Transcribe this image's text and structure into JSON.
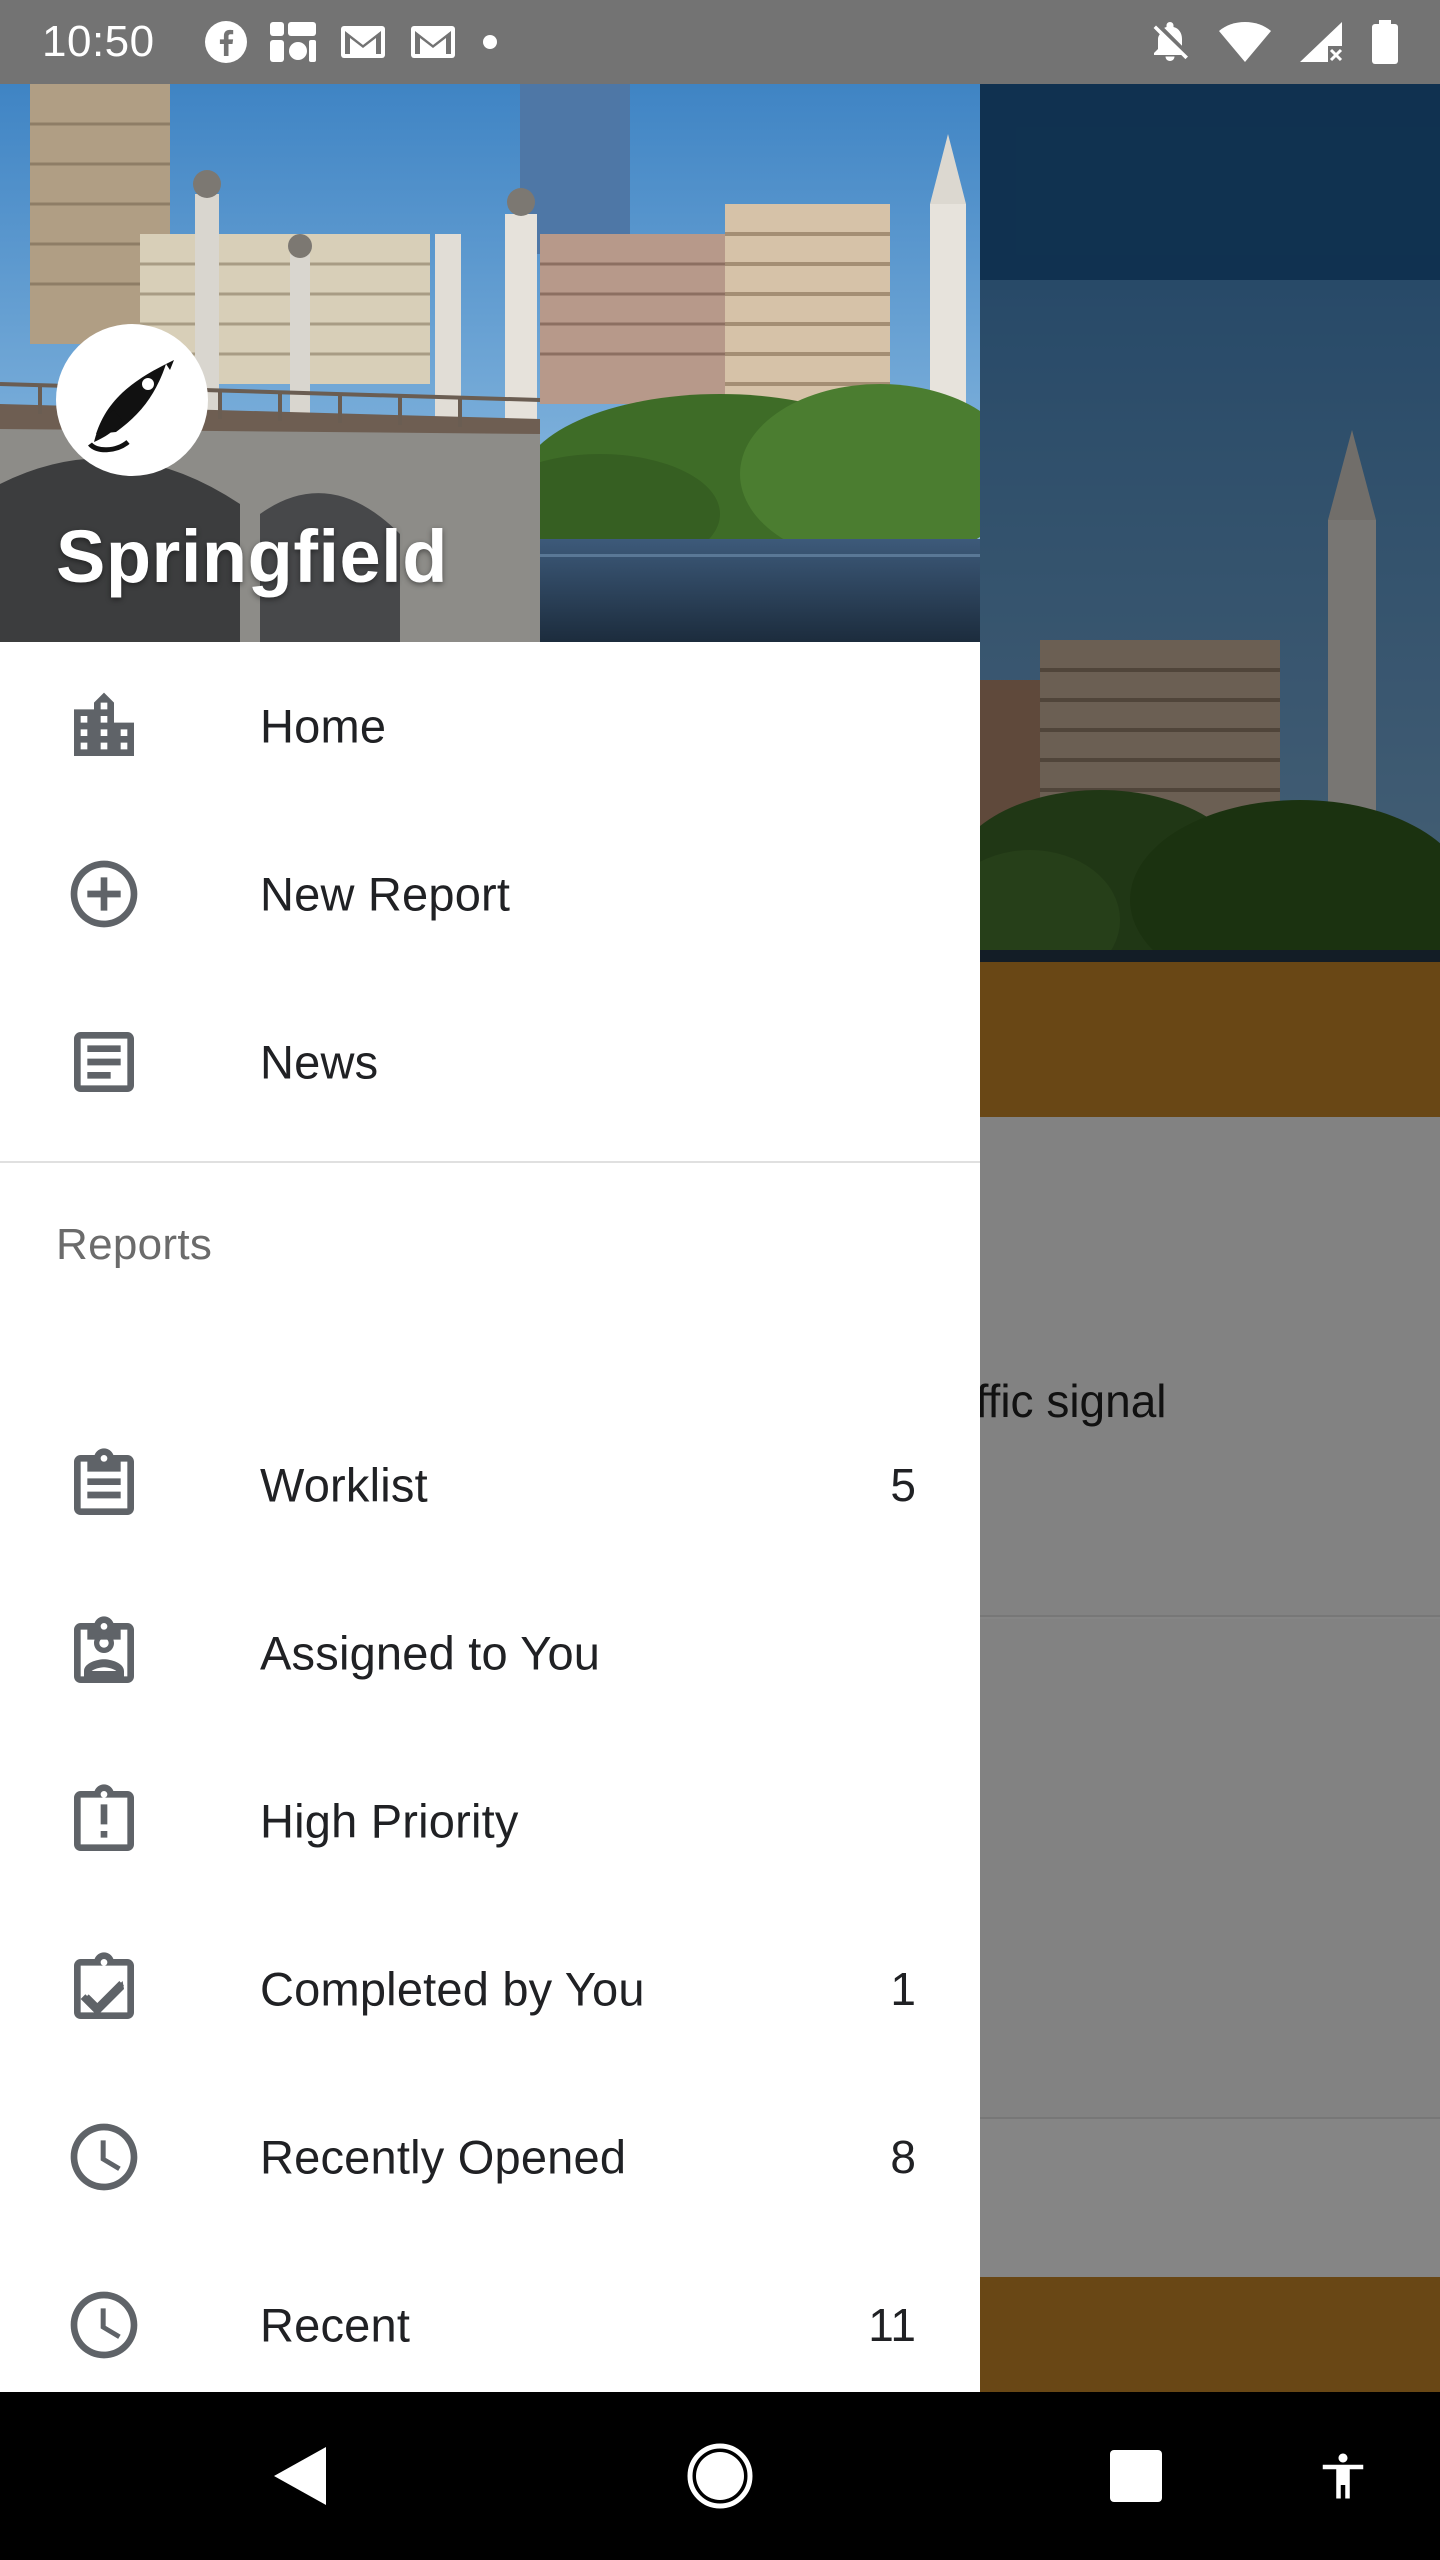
{
  "status_bar": {
    "time": "10:50",
    "left_icons": [
      "facebook-icon",
      "feed-icon",
      "gmail-icon",
      "gmail-icon",
      "dot-icon"
    ],
    "right_icons": [
      "notifications-off-icon",
      "wifi-icon",
      "signal-icon",
      "battery-icon"
    ]
  },
  "drawer": {
    "header": {
      "city_name": "Springfield"
    },
    "primary_items": [
      {
        "label": "Home",
        "icon": "city-icon"
      },
      {
        "label": "New Report",
        "icon": "add-circle-icon"
      },
      {
        "label": "News",
        "icon": "article-icon"
      }
    ],
    "reports_section": {
      "heading": "Reports",
      "items": [
        {
          "label": "Worklist",
          "count": "5",
          "icon": "clipboard-list-icon"
        },
        {
          "label": "Assigned to You",
          "count": "",
          "icon": "clipboard-person-icon"
        },
        {
          "label": "High Priority",
          "count": "",
          "icon": "clipboard-alert-icon"
        },
        {
          "label": "Completed by You",
          "count": "1",
          "icon": "clipboard-check-icon"
        },
        {
          "label": "Recently Opened",
          "count": "8",
          "icon": "clock-icon"
        },
        {
          "label": "Recent",
          "count": "11",
          "icon": "clock-icon"
        }
      ]
    }
  },
  "background": {
    "card_text": "affic signal"
  },
  "navigation_bar": {
    "buttons": [
      "back-icon",
      "home-icon",
      "recents-icon",
      "accessibility-icon"
    ]
  },
  "colors": {
    "app_bar": "#1f5f99",
    "accent_gold": "#c9892a",
    "icon_gray": "#5f6368",
    "text_primary": "#202124",
    "section_gray": "#6b6b6b"
  }
}
